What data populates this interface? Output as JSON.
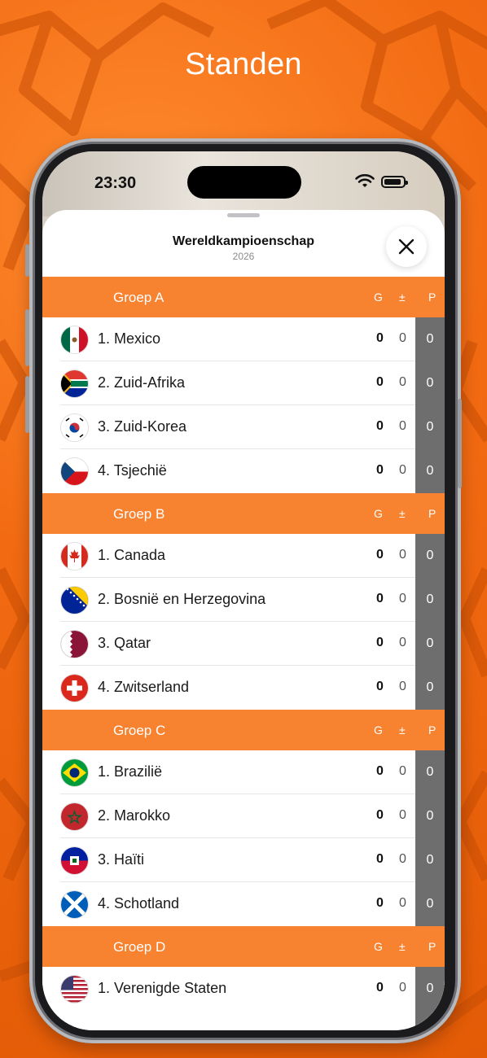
{
  "headline": "Standen",
  "status": {
    "time": "23:30"
  },
  "sheet": {
    "title": "Wereldkampioenschap",
    "subtitle": "2026"
  },
  "columns": {
    "g": "G",
    "pm": "±",
    "p": "P"
  },
  "colors": {
    "accent": "#f7822f",
    "points_column": "#6e6e6e",
    "background": "#f26a12"
  },
  "groups": [
    {
      "name": "Groep A",
      "teams": [
        {
          "label": "1. Mexico",
          "flag": "mexico-flag-icon",
          "g": "0",
          "pm": "0",
          "p": "0"
        },
        {
          "label": "2. Zuid-Afrika",
          "flag": "south-africa-flag-icon",
          "g": "0",
          "pm": "0",
          "p": "0"
        },
        {
          "label": "3. Zuid-Korea",
          "flag": "south-korea-flag-icon",
          "g": "0",
          "pm": "0",
          "p": "0"
        },
        {
          "label": "4. Tsjechië",
          "flag": "czechia-flag-icon",
          "g": "0",
          "pm": "0",
          "p": "0"
        }
      ]
    },
    {
      "name": "Groep B",
      "teams": [
        {
          "label": "1. Canada",
          "flag": "canada-flag-icon",
          "g": "0",
          "pm": "0",
          "p": "0"
        },
        {
          "label": "2. Bosnië en Herzegovina",
          "flag": "bosnia-flag-icon",
          "g": "0",
          "pm": "0",
          "p": "0"
        },
        {
          "label": "3. Qatar",
          "flag": "qatar-flag-icon",
          "g": "0",
          "pm": "0",
          "p": "0"
        },
        {
          "label": "4. Zwitserland",
          "flag": "switzerland-flag-icon",
          "g": "0",
          "pm": "0",
          "p": "0"
        }
      ]
    },
    {
      "name": "Groep C",
      "teams": [
        {
          "label": "1. Brazilië",
          "flag": "brazil-flag-icon",
          "g": "0",
          "pm": "0",
          "p": "0"
        },
        {
          "label": "2. Marokko",
          "flag": "morocco-flag-icon",
          "g": "0",
          "pm": "0",
          "p": "0"
        },
        {
          "label": "3. Haïti",
          "flag": "haiti-flag-icon",
          "g": "0",
          "pm": "0",
          "p": "0"
        },
        {
          "label": "4. Schotland",
          "flag": "scotland-flag-icon",
          "g": "0",
          "pm": "0",
          "p": "0"
        }
      ]
    },
    {
      "name": "Groep D",
      "teams": [
        {
          "label": "1. Verenigde Staten",
          "flag": "usa-flag-icon",
          "g": "0",
          "pm": "0",
          "p": "0"
        }
      ]
    }
  ]
}
